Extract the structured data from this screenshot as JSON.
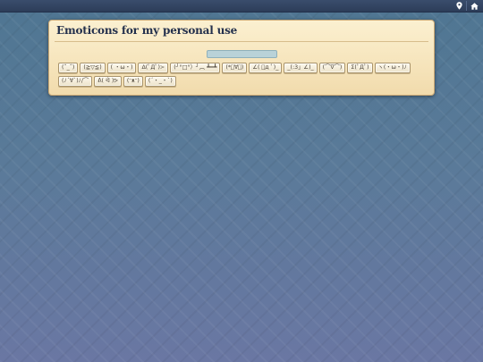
{
  "topbar": {
    "icons": [
      "map-marker-icon",
      "home-icon"
    ],
    "background": "#2d3d59"
  },
  "panel": {
    "title": "Emoticons for my personal use",
    "copy_field_value": "",
    "copy_field_color": "#b9d2d8"
  },
  "emoticons": [
    "(ˆ_ˆ)",
    "(≧▽≦)",
    "( ・ω・)",
    "Δ(ﾟДﾟ)≻",
    "(╯°□°）╯︵ ┻━┻",
    "(*ﾟ∀ﾟ)",
    "∠( ﾟд ﾟ)_",
    "_(:3」∠)_",
    "(⌒∇⌒)",
    "Σ(ﾟДﾟ)",
    "ヽ(・ω・)ﾉ",
    "(ﾉ´∀`)ﾉ/⌒",
    "ᕕ( ᐛ )ᕗ",
    "(ᵔᴥᵔ)",
    "(´・_・`)"
  ]
}
